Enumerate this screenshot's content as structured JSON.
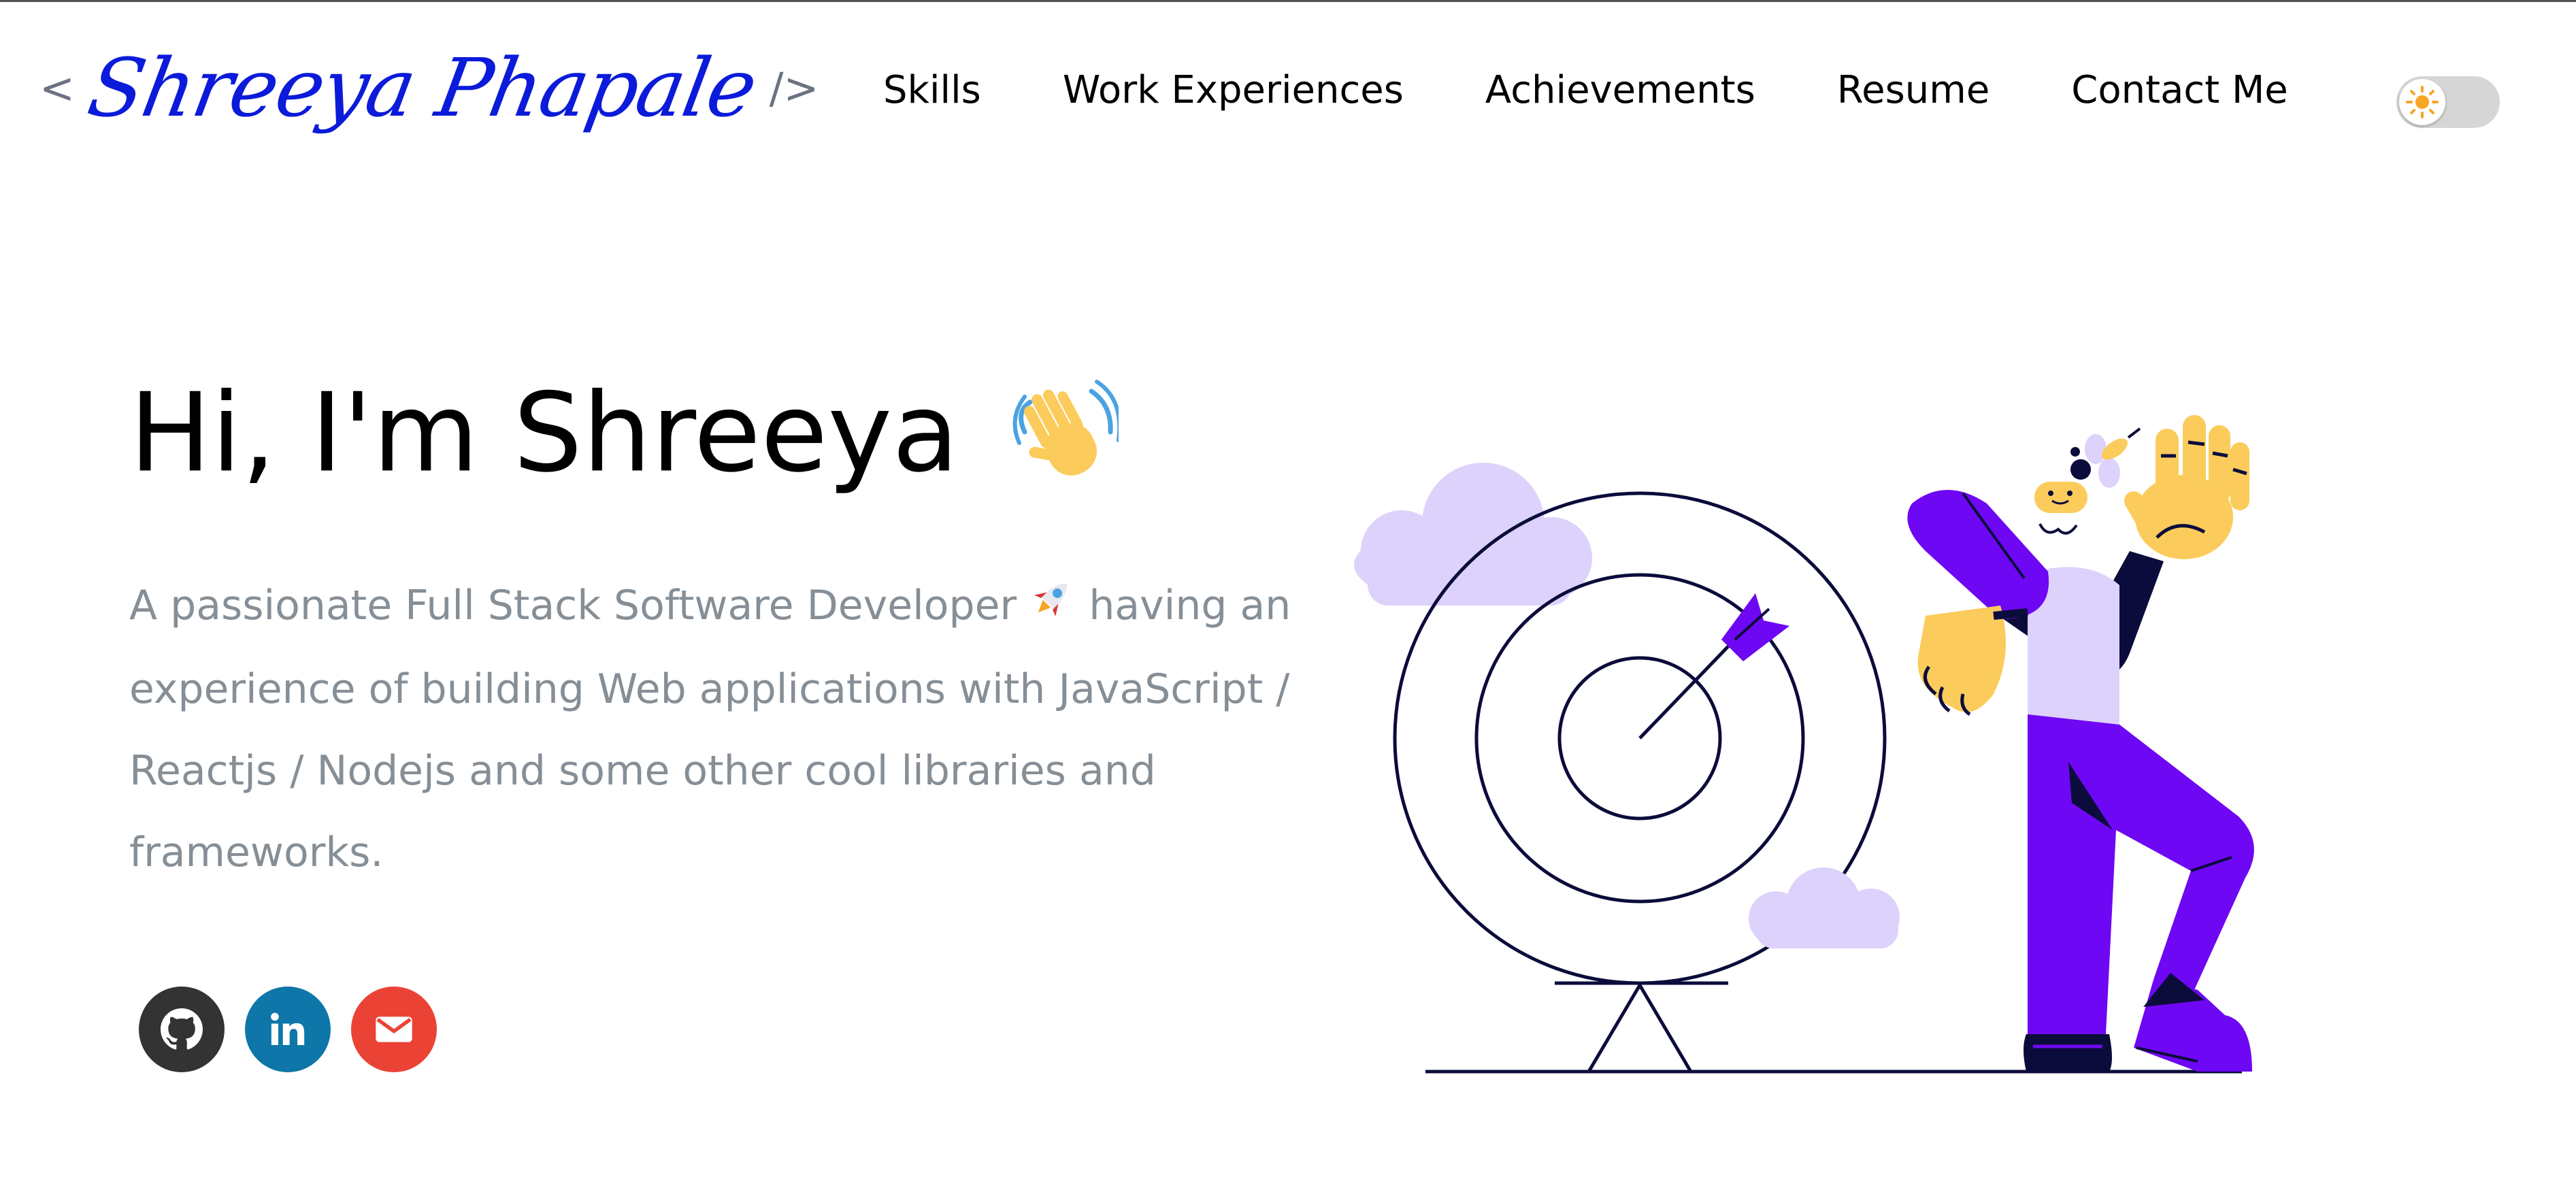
{
  "header": {
    "logo": {
      "open": "<",
      "name": "Shreeya Phapale",
      "close": "/>"
    },
    "nav": [
      "Skills",
      "Work Experiences",
      "Achievements",
      "Resume",
      "Contact Me"
    ],
    "theme_toggle": {
      "icon": "sun-icon"
    }
  },
  "hero": {
    "greeting": "Hi, I'm Shreeya",
    "greeting_emoji": "waving-hand-icon",
    "intro_before": "A passionate Full Stack Software Developer",
    "intro_emoji": "rocket-icon",
    "intro_after": "having an experience of building Web applications with JavaScript / Reactjs / Nodejs and some other cool libraries and frameworks.",
    "socials": [
      {
        "icon": "github-icon",
        "color": "#333333"
      },
      {
        "icon": "linkedin-icon",
        "color": "#0e76a8"
      },
      {
        "icon": "email-icon",
        "color": "#ea4335"
      }
    ]
  },
  "colors": {
    "logo": "#0b1bd9",
    "accent_purple": "#6e07f3",
    "light_purple": "#ddd2fb",
    "navy": "#0b0c3b",
    "skin_yellow": "#fbcb5c",
    "muted_text": "#868e96",
    "sun": "#f8a524"
  }
}
